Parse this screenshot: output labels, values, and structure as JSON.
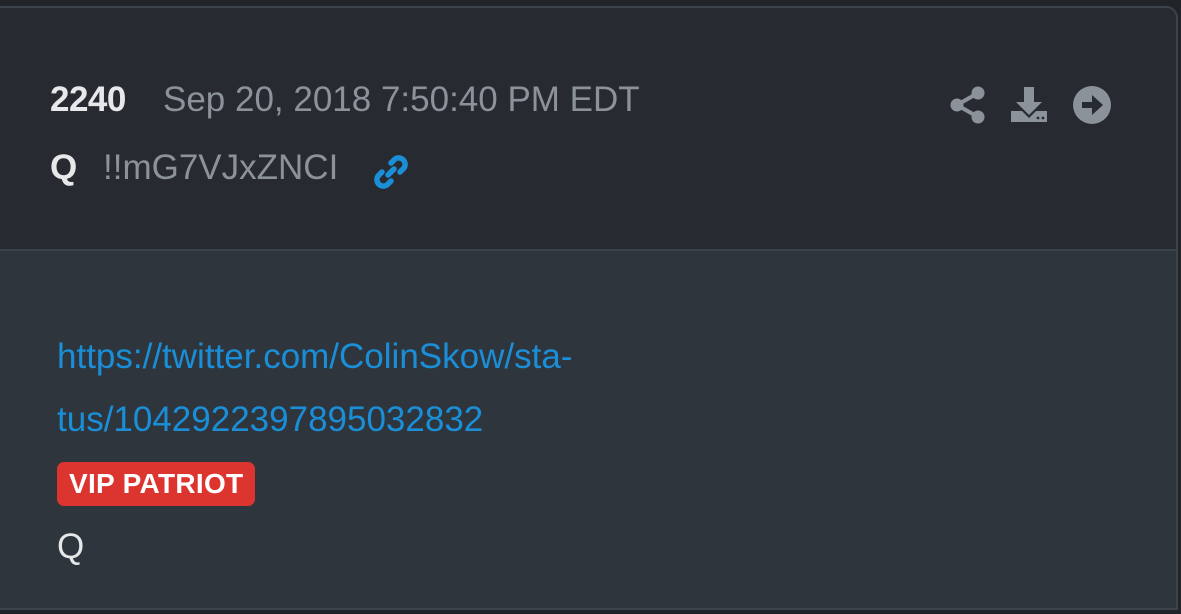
{
  "post": {
    "number": "2240",
    "date": "Sep 20, 2018 7:50:40 PM EDT",
    "author": "Q",
    "tripcode": "!!mG7VJxZNCI",
    "link_line1": "https://twitter.com/ColinSkow/sta-",
    "link_line2": "tus/1042922397895032832",
    "badge": "VIP PATRIOT",
    "signature": "Q"
  },
  "icons": {
    "permalink": "link-icon",
    "share": "share-icon",
    "download": "download-icon",
    "next": "arrow-circle-right-icon"
  },
  "colors": {
    "header_bg": "#272b31",
    "body_bg": "#2e353d",
    "link": "#1a8fd8",
    "badge_bg": "#dc3530",
    "muted_text": "#8b9299",
    "primary_text": "#e6e8ea"
  }
}
